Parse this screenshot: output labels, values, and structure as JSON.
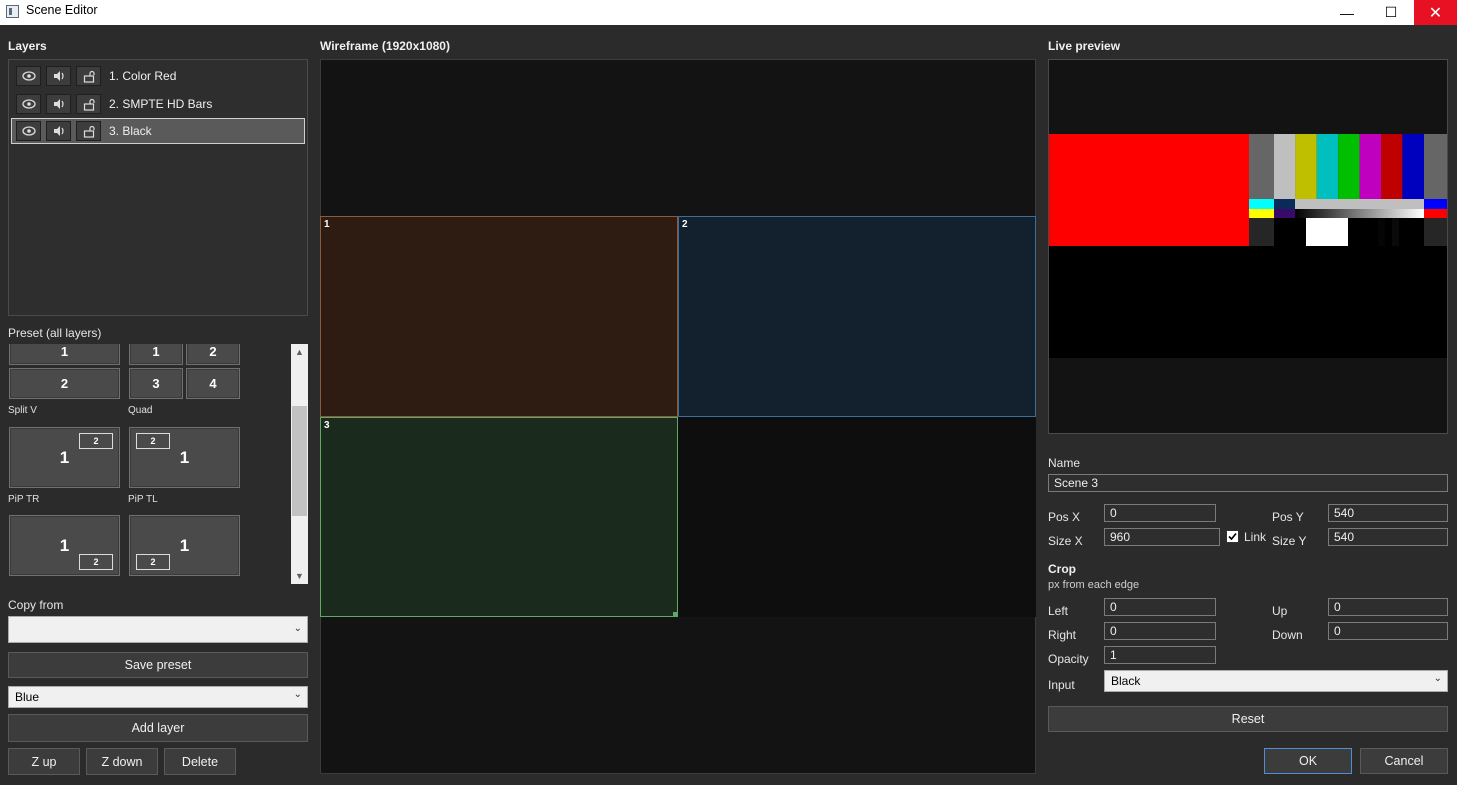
{
  "window": {
    "title": "Scene Editor",
    "minimize": "—",
    "maximize": "☐",
    "close": "✕"
  },
  "layers": {
    "heading": "Layers",
    "items": [
      {
        "name": "1. Color Red",
        "selected": false
      },
      {
        "name": "2. SMPTE HD Bars",
        "selected": false
      },
      {
        "name": "3. Black",
        "selected": true
      }
    ]
  },
  "presets": {
    "heading": "Preset (all layers)",
    "split_v": {
      "cells": [
        "1",
        "2"
      ],
      "caption": "Split V"
    },
    "quad": {
      "cells": [
        "1",
        "2",
        "3",
        "4"
      ],
      "caption": "Quad"
    },
    "pip_tr": {
      "main": "1",
      "pip": "2",
      "caption": "PiP TR"
    },
    "pip_tl": {
      "main": "1",
      "pip": "2",
      "caption": "PiP TL"
    },
    "pip_br": {
      "main": "1",
      "pip": "2"
    },
    "pip_bl": {
      "main": "1",
      "pip": "2"
    }
  },
  "copy_from": {
    "label": "Copy from",
    "value": ""
  },
  "save_preset_label": "Save preset",
  "color_select": {
    "value": "Blue"
  },
  "add_layer_label": "Add layer",
  "z_up_label": "Z up",
  "z_down_label": "Z down",
  "delete_label": "Delete",
  "wireframe": {
    "heading": "Wireframe (1920x1080)",
    "regions": [
      {
        "label": "1",
        "color": "#2e1c12",
        "border": "#8a5a3a"
      },
      {
        "label": "2",
        "color": "#13212e",
        "border": "#3c6e9c"
      },
      {
        "label": "3",
        "color": "#1a2a1c",
        "border": "#62a864"
      }
    ]
  },
  "preview": {
    "heading": "Live preview"
  },
  "properties": {
    "name_label": "Name",
    "name_value": "Scene 3",
    "pos_x_label": "Pos X",
    "pos_x_value": "0",
    "pos_y_label": "Pos Y",
    "pos_y_value": "540",
    "size_x_label": "Size X",
    "size_x_value": "960",
    "size_y_label": "Size Y",
    "size_y_value": "540",
    "link_label": "Link",
    "link_checked": true,
    "crop_heading": "Crop",
    "crop_hint": "px from each edge",
    "left_label": "Left",
    "left_value": "0",
    "up_label": "Up",
    "up_value": "0",
    "right_label": "Right",
    "right_value": "0",
    "down_label": "Down",
    "down_value": "0",
    "opacity_label": "Opacity",
    "opacity_value": "1",
    "input_label": "Input",
    "input_value": "Black"
  },
  "reset_label": "Reset",
  "ok_label": "OK",
  "cancel_label": "Cancel"
}
